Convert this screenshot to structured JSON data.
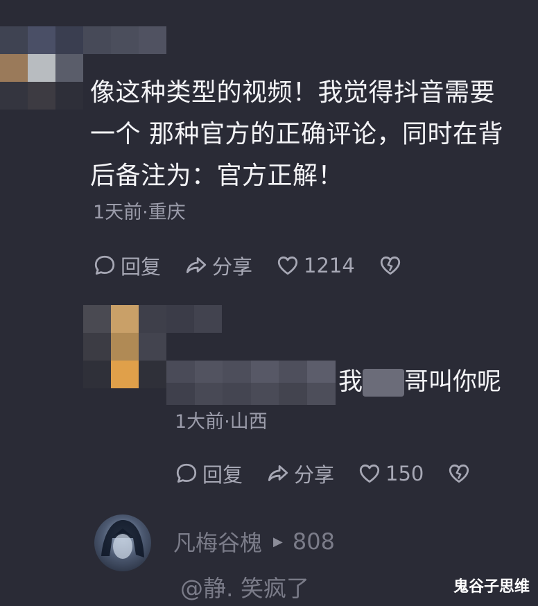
{
  "top_comment": {
    "text": "像这种类型的视频！我觉得抖音需要一个 那种官方的正确评论，同时在背后备注为：官方正解！",
    "meta": "1天前·重庆",
    "actions": {
      "reply_label": "回复",
      "share_label": "分享",
      "like_count": "1214"
    }
  },
  "reply_comment": {
    "text_visible_start": "我",
    "text_visible_end": "哥叫你呢",
    "meta": "1大前·山西",
    "actions": {
      "reply_label": "回复",
      "share_label": "分享",
      "like_count": "150"
    }
  },
  "bottom_comment": {
    "username": "凡梅谷槐",
    "level": "808",
    "mention": "@静. 笑疯了"
  },
  "watermark": "鬼谷子思维",
  "icons": {
    "reply": "comment-bubble-icon",
    "share": "share-arrow-icon",
    "like": "heart-icon",
    "dislike": "broken-heart-icon"
  },
  "colors": {
    "background": "#2a2b36",
    "text_primary": "#f4f4f7",
    "text_secondary": "#9b9caa"
  }
}
